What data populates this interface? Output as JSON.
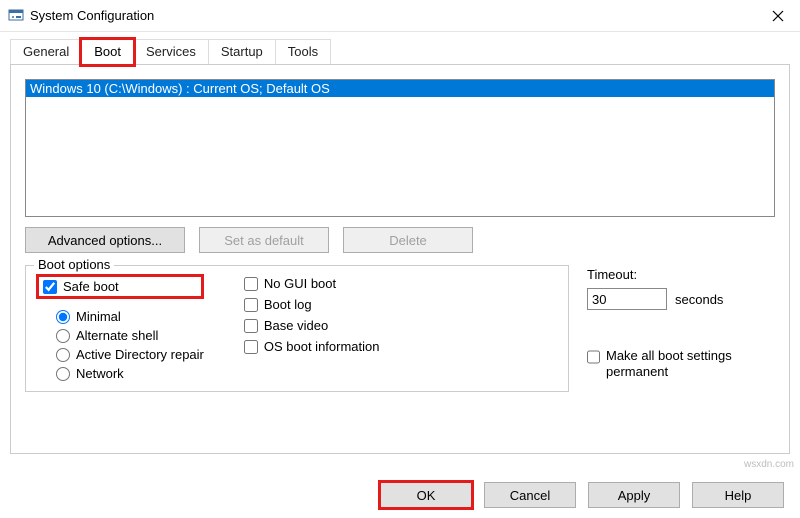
{
  "window": {
    "title": "System Configuration"
  },
  "tabs": {
    "general": "General",
    "boot": "Boot",
    "services": "Services",
    "startup": "Startup",
    "tools": "Tools"
  },
  "boot_list": {
    "item0": "Windows 10 (C:\\Windows) : Current OS; Default OS"
  },
  "buttons": {
    "advanced": "Advanced options...",
    "set_default": "Set as default",
    "delete": "Delete",
    "ok": "OK",
    "cancel": "Cancel",
    "apply": "Apply",
    "help": "Help"
  },
  "boot_options": {
    "legend": "Boot options",
    "safe_boot": "Safe boot",
    "minimal": "Minimal",
    "alt_shell": "Alternate shell",
    "ad_repair": "Active Directory repair",
    "network": "Network",
    "no_gui": "No GUI boot",
    "boot_log": "Boot log",
    "base_video": "Base video",
    "os_info": "OS boot information"
  },
  "timeout": {
    "label": "Timeout:",
    "value": "30",
    "unit": "seconds"
  },
  "permanent": "Make all boot settings permanent",
  "watermark": "wsxdn.com"
}
